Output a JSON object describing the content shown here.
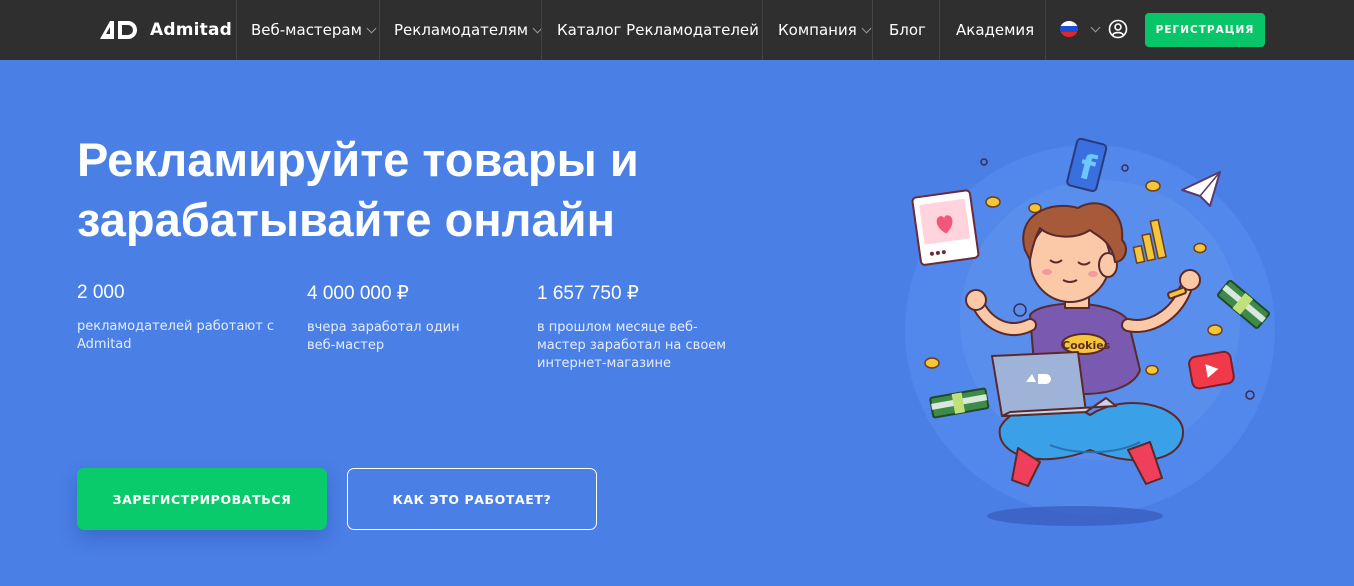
{
  "brand": {
    "name": "Admitad"
  },
  "nav": {
    "items": [
      {
        "label": "Веб-мастерам",
        "has_dropdown": true
      },
      {
        "label": "Рекламодателям",
        "has_dropdown": true
      },
      {
        "label": "Каталог Рекламодателей",
        "has_dropdown": false
      },
      {
        "label": "Компания",
        "has_dropdown": true
      },
      {
        "label": "Блог",
        "has_dropdown": false
      },
      {
        "label": "Академия",
        "has_dropdown": false
      }
    ],
    "language_icon": "russia-flag-icon",
    "user_icon": "user-icon",
    "register_label": "РЕГИСТРАЦИЯ"
  },
  "hero": {
    "headline_line1": "Рекламируйте товары и",
    "headline_line2": "зарабатывайте онлайн",
    "stats": [
      {
        "value": "2 000",
        "description": "рекламодателей работают с Admitad"
      },
      {
        "value": "4 000 000 ₽",
        "description": "вчера заработал один веб-мастер"
      },
      {
        "value": "1 657 750 ₽",
        "description": "в прошлом месяце веб-мастер заработал на своем интернет-магазине"
      }
    ],
    "primary_button": "ЗАРЕГИСТРИРОВАТЬСЯ",
    "secondary_button": "КАК ЭТО РАБОТАЕТ?",
    "illustration": {
      "shirt_text": "Cookies",
      "social_icon_letter": "f"
    }
  },
  "colors": {
    "background": "#4a7fe6",
    "nav_background": "#2f2f2f",
    "accent_green": "#09cb6c"
  }
}
